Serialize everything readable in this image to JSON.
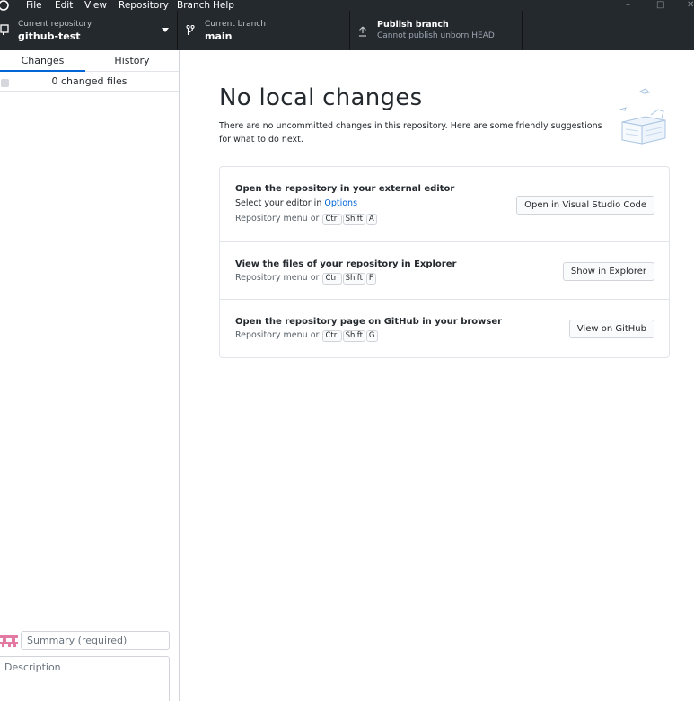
{
  "menu": {
    "items": [
      "File",
      "Edit",
      "View",
      "Repository",
      "Branch",
      "Help"
    ],
    "window_controls": [
      "minimize-icon",
      "maximize-icon",
      "close-icon"
    ]
  },
  "toolbar": {
    "repository": {
      "label": "Current repository",
      "value": "github-test",
      "icon": "repo-icon"
    },
    "branch": {
      "label": "Current branch",
      "value": "main",
      "icon": "branch-icon"
    },
    "publish": {
      "title": "Publish branch",
      "subtitle": "Cannot publish unborn HEAD",
      "icon": "upload-icon"
    }
  },
  "sidebar": {
    "tabs": [
      {
        "label": "Changes",
        "active": true
      },
      {
        "label": "History",
        "active": false
      }
    ],
    "changed_files_label": "0 changed files",
    "commit": {
      "summary_placeholder": "Summary (required)",
      "description_placeholder": "Description"
    }
  },
  "main": {
    "title": "No local changes",
    "subtitle": "There are no uncommitted changes in this repository. Here are some friendly suggestions for what to do next.",
    "actions": [
      {
        "title": "Open the repository in your external editor",
        "editor_prefix": "Select your editor in ",
        "editor_link": "Options",
        "shortcut_prefix": "Repository menu or",
        "keys": [
          "Ctrl",
          "Shift",
          "A"
        ],
        "button": "Open in Visual Studio Code"
      },
      {
        "title": "View the files of your repository in Explorer",
        "shortcut_prefix": "Repository menu or",
        "keys": [
          "Ctrl",
          "Shift",
          "F"
        ],
        "button": "Show in Explorer"
      },
      {
        "title": "Open the repository page on GitHub in your browser",
        "shortcut_prefix": "Repository menu or",
        "keys": [
          "Ctrl",
          "Shift",
          "G"
        ],
        "button": "View on GitHub"
      }
    ]
  },
  "colors": {
    "titlebar": "#24292e",
    "accent": "#0366d6",
    "border": "#d1d5da"
  }
}
